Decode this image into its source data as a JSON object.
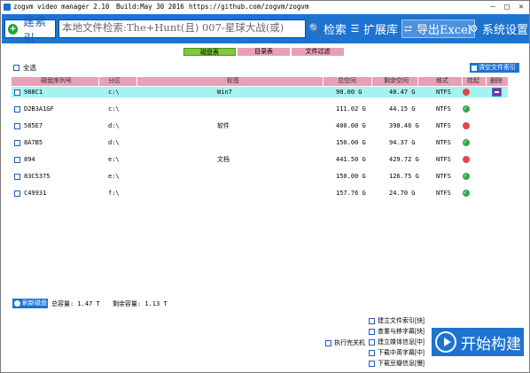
{
  "window": {
    "app_name": "zogvm video manager 2.10",
    "build": "Build:May 30 2016",
    "url": "https://github.com/zogvm/zogvm"
  },
  "toolbar": {
    "build_index_label": "建索引",
    "search_placeholder": "本地文件检索:The+Hunt(且) 007-星球大战(或)",
    "search_label": "检索",
    "extend_label": "扩展库",
    "export_label": "导出Excel",
    "settings_label": "系统设置"
  },
  "tabs": {
    "disk": "磁盘表",
    "dir": "目录表",
    "filter": "文件过滤"
  },
  "select_all_label": "全选",
  "clear_index_label": "清空文件索引",
  "table": {
    "headers": [
      "磁盘序列号",
      "分区",
      "标签",
      "总空间",
      "剩余空间",
      "格式",
      "挂起",
      "删除"
    ],
    "rows": [
      {
        "serial": "988C1",
        "part": "c:\\",
        "label": "Win7",
        "total": "90.00 G",
        "free": "40.47 G",
        "fmt": "NTFS",
        "status": "red",
        "selected": true
      },
      {
        "serial": "D2B3A1GF",
        "part": "c:\\",
        "label": "",
        "total": "111.02 G",
        "free": "44.15 G",
        "fmt": "NTFS",
        "status": "green",
        "selected": false
      },
      {
        "serial": "585E7",
        "part": "d:\\",
        "label": "软件",
        "total": "400.00 G",
        "free": "398.46 G",
        "fmt": "NTFS",
        "status": "red",
        "selected": false
      },
      {
        "serial": "8A7B5",
        "part": "d:\\",
        "label": "",
        "total": "150.00 G",
        "free": "94.37 G",
        "fmt": "NTFS",
        "status": "green",
        "selected": false
      },
      {
        "serial": "894",
        "part": "e:\\",
        "label": "文档",
        "total": "441.50 G",
        "free": "429.72 G",
        "fmt": "NTFS",
        "status": "red",
        "selected": false
      },
      {
        "serial": "83C5375",
        "part": "e:\\",
        "label": "",
        "total": "150.00 G",
        "free": "126.75 G",
        "fmt": "NTFS",
        "status": "green",
        "selected": false
      },
      {
        "serial": "C49931",
        "part": "f:\\",
        "label": "",
        "total": "157.76 G",
        "free": "24.70 G",
        "fmt": "NTFS",
        "status": "green",
        "selected": false
      }
    ]
  },
  "refresh_label": "刷新磁盘",
  "capacity": {
    "total": "总容量: 1.47 T",
    "free": "剩余容量: 1.13 T"
  },
  "shutdown_label": "执行完关机",
  "options": [
    "建立文件索引[快]",
    "查重与移字幕[快]",
    "建立媒体信息[中]",
    "下载中英字幕[中]",
    "下载豆瓣信息[慢]"
  ],
  "start_label": "开始构建",
  "colors": {
    "accent": "#1c73d0",
    "selected_row": "#a6f2f2",
    "header": "#e8a0b6",
    "tab_active": "#7dca3f"
  }
}
